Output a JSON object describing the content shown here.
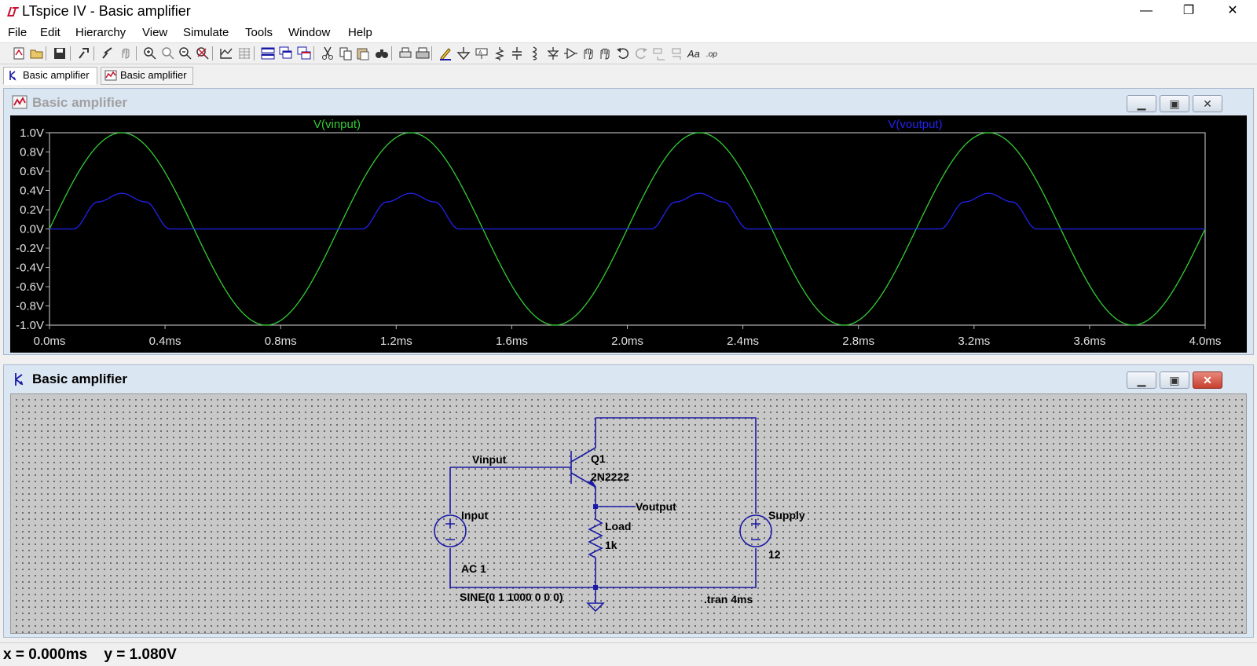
{
  "window": {
    "title": "LTspice IV - Basic amplifier",
    "minimize": "—",
    "maximize": "❐",
    "close": "✕"
  },
  "menu": [
    {
      "label": "File"
    },
    {
      "label": "Edit"
    },
    {
      "label": "Hierarchy"
    },
    {
      "label": "View"
    },
    {
      "label": "Simulate"
    },
    {
      "label": "Tools"
    },
    {
      "label": "Window"
    },
    {
      "label": "Help"
    }
  ],
  "toolbar_icons": [
    "new-schematic-icon",
    "open-icon",
    "save-icon",
    "control-panel-icon",
    "run-icon",
    "halt-icon",
    "zoom-in-icon",
    "zoom-out-icon",
    "zoom-full-icon",
    "zoom-cancel-icon",
    "autorange-icon",
    "grid-icon",
    "tile-horizontal-icon",
    "cascade-icon",
    "tile-vertical-icon",
    "cut-icon",
    "copy-icon",
    "paste-icon",
    "find-icon",
    "print-preview-icon",
    "print-icon",
    "draw-wire-icon",
    "ground-icon",
    "label-net-icon",
    "resistor-icon",
    "capacitor-icon",
    "inductor-icon",
    "diode-icon",
    "component-icon",
    "move-icon",
    "drag-icon",
    "undo-icon",
    "redo-icon",
    "rotate-icon",
    "mirror-icon",
    "text-icon",
    "spice-directive-icon"
  ],
  "tabs": [
    {
      "label": "Basic amplifier",
      "kind": "schematic",
      "active": true
    },
    {
      "label": "Basic amplifier",
      "kind": "waveform",
      "active": false
    }
  ],
  "plot_window": {
    "title": "Basic amplifier",
    "traces": [
      {
        "name": "V(vinput)",
        "color": "#33cc33"
      },
      {
        "name": "V(voutput)",
        "color": "#2222ee"
      }
    ]
  },
  "chart_data": {
    "type": "line",
    "x": [
      0.0,
      0.1,
      0.2,
      0.25,
      0.3,
      0.4,
      0.5,
      0.6,
      0.7,
      0.75,
      0.8,
      0.9,
      1.0
    ],
    "x_unit": "ms",
    "period_ms": 1.0,
    "xlim": [
      0.0,
      4.0
    ],
    "ylim": [
      -1.0,
      1.0
    ],
    "x_ticks": [
      "0.0ms",
      "0.4ms",
      "0.8ms",
      "1.2ms",
      "1.6ms",
      "2.0ms",
      "2.4ms",
      "2.8ms",
      "3.2ms",
      "3.6ms",
      "4.0ms"
    ],
    "y_ticks": [
      "1.0V",
      "0.8V",
      "0.6V",
      "0.4V",
      "0.2V",
      "0.0V",
      "-0.2V",
      "-0.4V",
      "-0.6V",
      "-0.8V",
      "-1.0V"
    ],
    "series": [
      {
        "name": "V(vinput)",
        "color": "#33cc33",
        "values": [
          0.0,
          0.588,
          0.951,
          1.0,
          0.951,
          0.588,
          0.0,
          -0.588,
          -0.951,
          -1.0,
          -0.951,
          -0.588,
          0.0
        ]
      },
      {
        "name": "V(voutput)",
        "color": "#2222ee",
        "values": [
          0.0,
          0.0,
          0.28,
          0.37,
          0.28,
          0.0,
          0.0,
          0.0,
          0.0,
          0.0,
          0.0,
          0.0,
          0.0
        ]
      }
    ],
    "grid": false,
    "background": "#000000"
  },
  "schematic_window": {
    "title": "Basic amplifier",
    "labels": {
      "vinput": "Vinput",
      "q1": "Q1",
      "q1_model": "2N2222",
      "voutput": "Voutput",
      "input": "Input",
      "load": "Load",
      "load_value": "1k",
      "supply": "Supply",
      "supply_value": "12",
      "ac": "AC 1",
      "sine": "SINE(0 1 1000 0 0 0)",
      "tran": ".tran 4ms"
    },
    "wire_color": "#1a1aa6"
  },
  "status": {
    "text": "x = 0.000ms    y = 1.080V"
  }
}
